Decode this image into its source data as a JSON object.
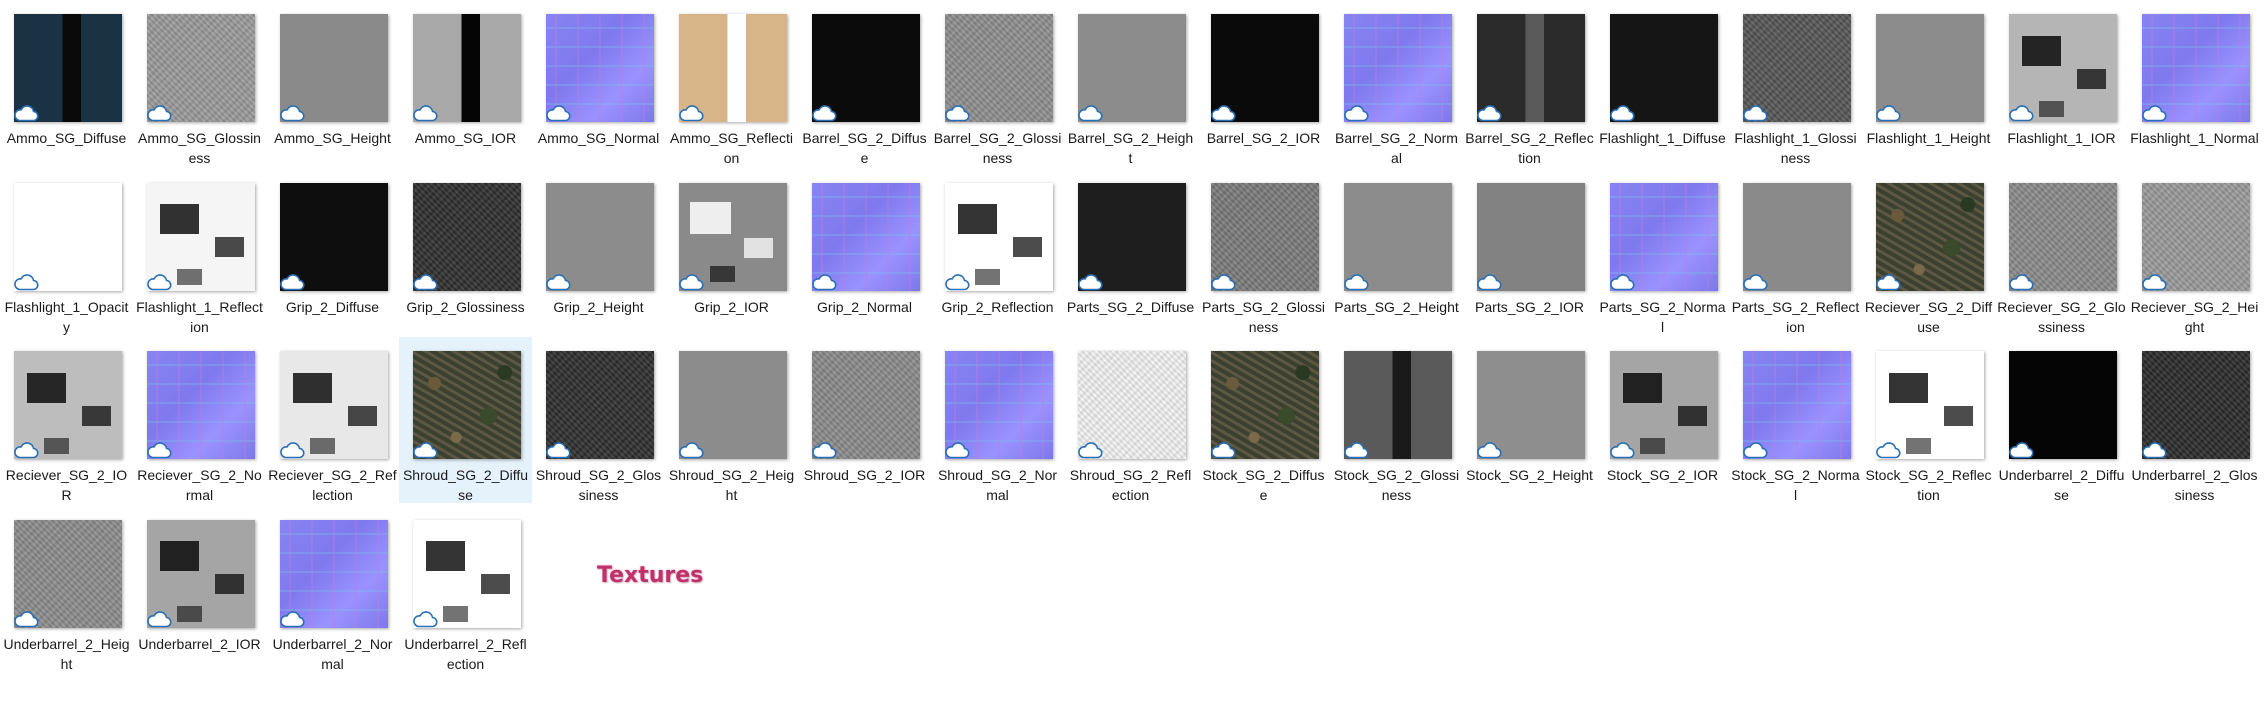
{
  "window": {
    "heading": "Textures"
  },
  "files": [
    {
      "name": "Ammo_SG_Diffuse",
      "kind": "split",
      "bg": "#1a3344",
      "fg": "#0a0a0a",
      "selected": false
    },
    {
      "name": "Ammo_SG_Glossiness",
      "kind": "noise",
      "bg": "#9a9a9a",
      "selected": false
    },
    {
      "name": "Ammo_SG_Height",
      "kind": "flat",
      "bg": "#8a8a8a",
      "selected": false
    },
    {
      "name": "Ammo_SG_IOR",
      "kind": "split",
      "bg": "#a8a8a8",
      "fg": "#050505",
      "selected": false
    },
    {
      "name": "Ammo_SG_Normal",
      "kind": "normal",
      "selected": false
    },
    {
      "name": "Ammo_SG_Reflection",
      "kind": "split",
      "bg": "#d8b588",
      "fg": "#ffffff",
      "selected": false
    },
    {
      "name": "Barrel_SG_2_Diffuse",
      "kind": "flat",
      "bg": "#0b0b0b",
      "selected": false
    },
    {
      "name": "Barrel_SG_2_Glossiness",
      "kind": "noise",
      "bg": "#8e8e8e",
      "selected": false
    },
    {
      "name": "Barrel_SG_2_Height",
      "kind": "flat",
      "bg": "#8c8c8c",
      "selected": false
    },
    {
      "name": "Barrel_SG_2_IOR",
      "kind": "flat",
      "bg": "#0a0a0a",
      "selected": false
    },
    {
      "name": "Barrel_SG_2_Normal",
      "kind": "normal",
      "selected": false
    },
    {
      "name": "Barrel_SG_2_Reflection",
      "kind": "split",
      "bg": "#2a2a2a",
      "fg": "#5a5a5a",
      "selected": false
    },
    {
      "name": "Flashlight_1_Diffuse",
      "kind": "flat",
      "bg": "#151515",
      "selected": false
    },
    {
      "name": "Flashlight_1_Glossiness",
      "kind": "noise",
      "bg": "#555555",
      "selected": false
    },
    {
      "name": "Flashlight_1_Height",
      "kind": "flat",
      "bg": "#8c8c8c",
      "selected": false
    },
    {
      "name": "Flashlight_1_IOR",
      "kind": "maskdark",
      "bg": "#b5b5b5",
      "selected": false
    },
    {
      "name": "Flashlight_1_Normal",
      "kind": "normal",
      "selected": false
    },
    {
      "name": "Flashlight_1_Opacity",
      "kind": "flat",
      "bg": "#ffffff",
      "selected": false
    },
    {
      "name": "Flashlight_1_Reflection",
      "kind": "maskdark",
      "bg": "#f5f5f5",
      "selected": false
    },
    {
      "name": "Grip_2_Diffuse",
      "kind": "flat",
      "bg": "#0e0e0e",
      "selected": false
    },
    {
      "name": "Grip_2_Glossiness",
      "kind": "noise",
      "bg": "#2e2e2e",
      "selected": false
    },
    {
      "name": "Grip_2_Height",
      "kind": "flat",
      "bg": "#8c8c8c",
      "selected": false
    },
    {
      "name": "Grip_2_IOR",
      "kind": "mask",
      "bg": "#8a8a8a",
      "selected": false
    },
    {
      "name": "Grip_2_Normal",
      "kind": "normal",
      "selected": false
    },
    {
      "name": "Grip_2_Reflection",
      "kind": "maskdark",
      "bg": "#ffffff",
      "selected": false
    },
    {
      "name": "Parts_SG_2_Diffuse",
      "kind": "flat",
      "bg": "#1e1e1e",
      "selected": false
    },
    {
      "name": "Parts_SG_2_Glossiness",
      "kind": "noise",
      "bg": "#7a7a7a",
      "selected": false
    },
    {
      "name": "Parts_SG_2_Height",
      "kind": "flat",
      "bg": "#8c8c8c",
      "selected": false
    },
    {
      "name": "Parts_SG_2_IOR",
      "kind": "flat",
      "bg": "#828282",
      "selected": false
    },
    {
      "name": "Parts_SG_2_Normal",
      "kind": "normal",
      "selected": false
    },
    {
      "name": "Parts_SG_2_Reflection",
      "kind": "flat",
      "bg": "#8a8a8a",
      "selected": false
    },
    {
      "name": "Reciever_SG_2_Diffuse",
      "kind": "camo",
      "selected": false
    },
    {
      "name": "Reciever_SG_2_Glossiness",
      "kind": "noise",
      "bg": "#8a8a8a",
      "selected": false
    },
    {
      "name": "Reciever_SG_2_Height",
      "kind": "noise",
      "bg": "#9a9a9a",
      "selected": false
    },
    {
      "name": "Reciever_SG_2_IOR",
      "kind": "maskdark",
      "bg": "#bdbdbd",
      "selected": false
    },
    {
      "name": "Reciever_SG_2_Normal",
      "kind": "normal",
      "selected": false
    },
    {
      "name": "Reciever_SG_2_Reflection",
      "kind": "maskdark",
      "bg": "#e8e8e8",
      "selected": false
    },
    {
      "name": "Shroud_SG_2_Diffuse",
      "kind": "camo",
      "selected": true
    },
    {
      "name": "Shroud_SG_2_Glossiness",
      "kind": "noise",
      "bg": "#2e2e2e",
      "selected": false
    },
    {
      "name": "Shroud_SG_2_Height",
      "kind": "flat",
      "bg": "#8c8c8c",
      "selected": false
    },
    {
      "name": "Shroud_SG_2_IOR",
      "kind": "noise",
      "bg": "#8a8a8a",
      "selected": false
    },
    {
      "name": "Shroud_SG_2_Normal",
      "kind": "normal",
      "selected": false
    },
    {
      "name": "Shroud_SG_2_Reflection",
      "kind": "noise",
      "bg": "#f2f2f2",
      "selected": false
    },
    {
      "name": "Stock_SG_2_Diffuse",
      "kind": "camo",
      "selected": false
    },
    {
      "name": "Stock_SG_2_Glossiness",
      "kind": "split",
      "bg": "#5a5a5a",
      "fg": "#1a1a1a",
      "selected": false
    },
    {
      "name": "Stock_SG_2_Height",
      "kind": "flat",
      "bg": "#8e8e8e",
      "selected": false
    },
    {
      "name": "Stock_SG_2_IOR",
      "kind": "maskdark",
      "bg": "#a5a5a5",
      "selected": false
    },
    {
      "name": "Stock_SG_2_Normal",
      "kind": "normal",
      "selected": false
    },
    {
      "name": "Stock_SG_2_Reflection",
      "kind": "maskdark",
      "bg": "#ffffff",
      "selected": false
    },
    {
      "name": "Underbarrel_2_Diffuse",
      "kind": "flat",
      "bg": "#050505",
      "selected": false
    },
    {
      "name": "Underbarrel_2_Glossiness",
      "kind": "noise",
      "bg": "#2a2a2a",
      "selected": false
    },
    {
      "name": "Underbarrel_2_Height",
      "kind": "noise",
      "bg": "#8c8c8c",
      "selected": false
    },
    {
      "name": "Underbarrel_2_IOR",
      "kind": "maskdark",
      "bg": "#a5a5a5",
      "selected": false
    },
    {
      "name": "Underbarrel_2_Normal",
      "kind": "normal",
      "selected": false
    },
    {
      "name": "Underbarrel_2_Reflection",
      "kind": "maskdark",
      "bg": "#ffffff",
      "selected": false
    }
  ],
  "icons": {
    "sync_status": "cloud-icon"
  }
}
